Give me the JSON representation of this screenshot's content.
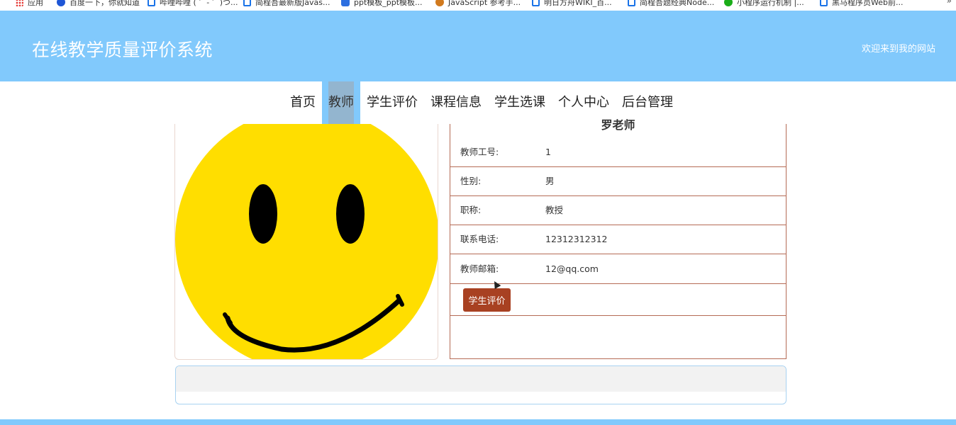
{
  "bookmarks": [
    {
      "label": "应用",
      "icon": "apps-icon"
    },
    {
      "label": "百度一下，你就知道",
      "icon": "paw-icon"
    },
    {
      "label": "哔哩哔哩 ( ゜- ゜)つ...",
      "icon": "bookmark-icon"
    },
    {
      "label": "简程吾最新版Javas...",
      "icon": "bookmark-icon"
    },
    {
      "label": "ppt模板_ppt模板...",
      "icon": "ppt-icon"
    },
    {
      "label": "JavaScript 参考手...",
      "icon": "js-icon"
    },
    {
      "label": "明日方舟WIKI_百...",
      "icon": "bookmark-icon"
    },
    {
      "label": "简程吾题经典Node...",
      "icon": "bookmark-icon"
    },
    {
      "label": "小程序运行机制 |...",
      "icon": "chat-icon"
    },
    {
      "label": "黑马程序员Web前...",
      "icon": "bookmark-icon"
    }
  ],
  "bookmarks_more": "»",
  "header": {
    "title": "在线教学质量评价系统",
    "welcome": "欢迎来到我的网站"
  },
  "nav": {
    "items": [
      "首页",
      "教师",
      "学生评价",
      "课程信息",
      "学生选课",
      "个人中心",
      "后台管理"
    ],
    "active": "教师"
  },
  "teacher": {
    "name": "罗老师",
    "photo": "smiley-face",
    "fields": [
      {
        "label": "教师工号:",
        "value": "1"
      },
      {
        "label": "性别:",
        "value": "男"
      },
      {
        "label": "职称:",
        "value": "教授"
      },
      {
        "label": "联系电话:",
        "value": "12312312312"
      },
      {
        "label": "教师邮箱:",
        "value": "12@qq.com"
      }
    ],
    "evaluate_button": "学生评价"
  },
  "colors": {
    "header_bg": "#81c9fc",
    "nav_active": "#93b5cf",
    "table_border": "#b56b55",
    "button_bg": "#a84122",
    "smiley_yellow": "#ffde00"
  }
}
